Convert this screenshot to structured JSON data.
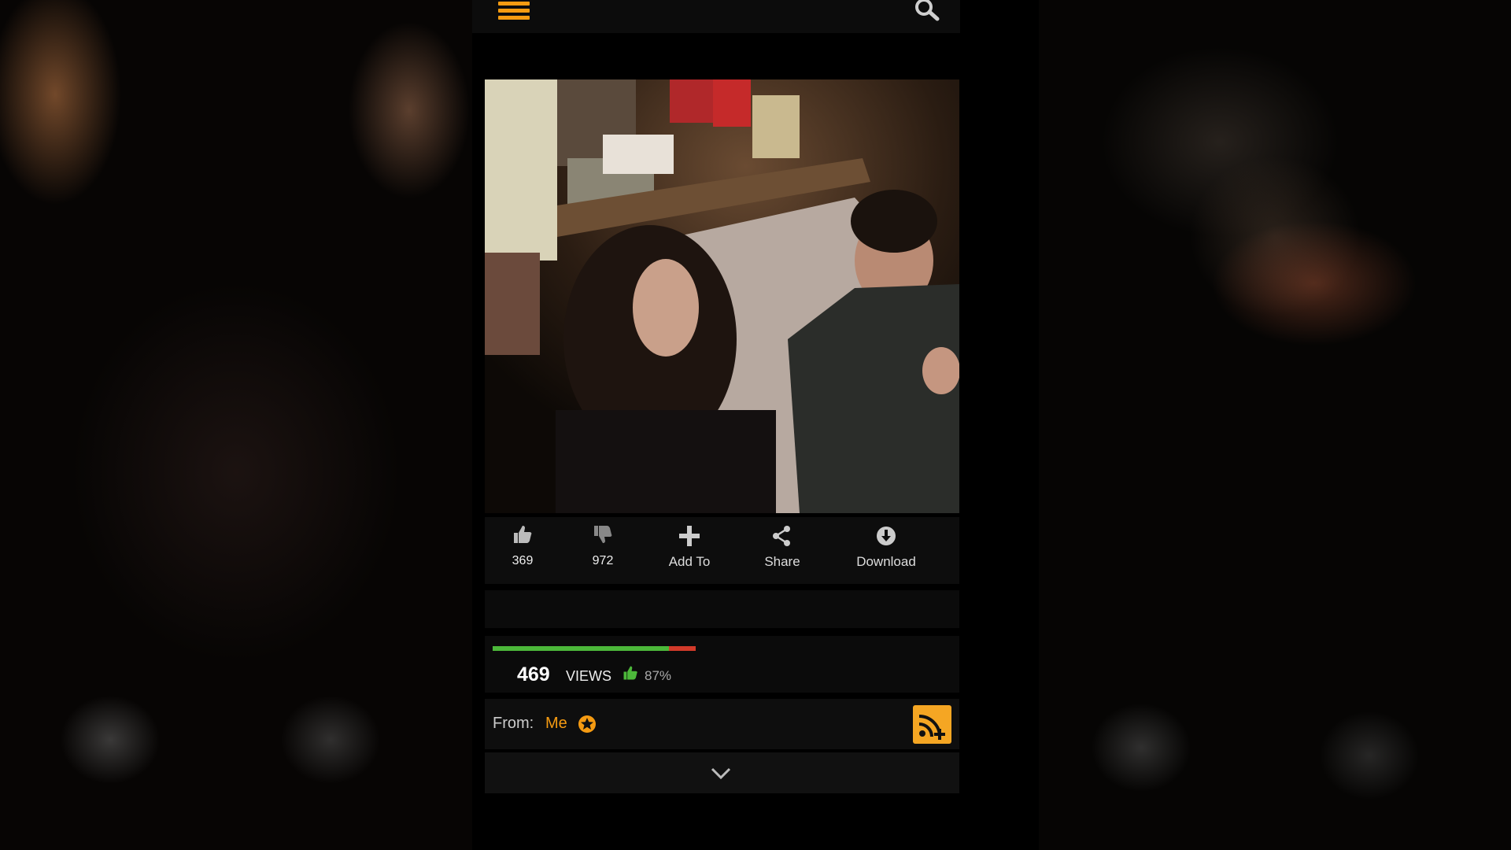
{
  "actions": {
    "like_count": "369",
    "dislike_count": "972",
    "add_to_label": "Add To",
    "share_label": "Share",
    "download_label": "Download"
  },
  "stats": {
    "views": "469",
    "views_label": "VIEWS",
    "rating_percent": "87%",
    "rating_fraction": 0.87
  },
  "uploader": {
    "from_label": "From:",
    "name": "Me"
  },
  "colors": {
    "accent": "#f59b12",
    "rating_good": "#4cb83a",
    "rating_bad": "#d23a2a"
  },
  "icons": [
    "hamburger-menu-icon",
    "search-icon",
    "thumbs-up-icon",
    "thumbs-down-icon",
    "plus-icon",
    "share-icon",
    "download-icon",
    "star-badge-icon",
    "subscribe-rss-icon",
    "chevron-down-icon"
  ]
}
